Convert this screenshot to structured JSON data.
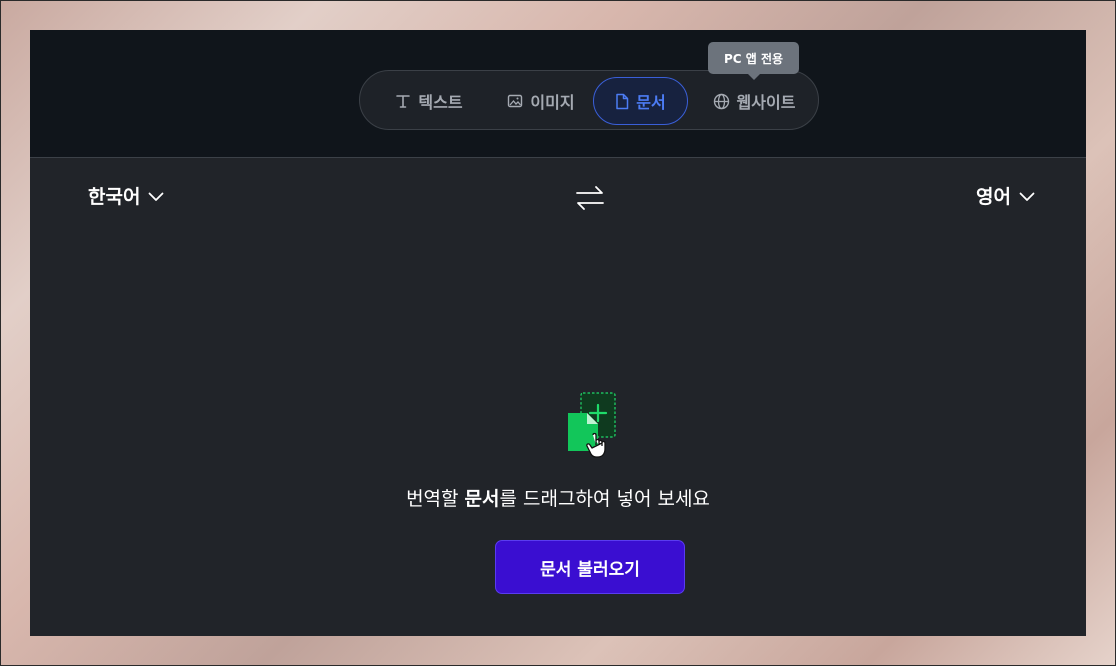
{
  "tabs": [
    {
      "label": "텍스트",
      "icon": "text-t-icon",
      "active": false
    },
    {
      "label": "이미지",
      "icon": "image-icon",
      "active": false
    },
    {
      "label": "문서",
      "icon": "document-icon",
      "active": true
    },
    {
      "label": "웹사이트",
      "icon": "globe-icon",
      "active": false
    }
  ],
  "tooltip": {
    "text": "PC 앱 전용"
  },
  "languages": {
    "source": "한국어",
    "target": "영어"
  },
  "dropzone": {
    "text_before": "번역할 ",
    "text_bold": "문서",
    "text_after": "를 드래그하여 넣어 보세요",
    "icon": "document-drop-icon"
  },
  "load_button": {
    "label": "문서 불러오기"
  },
  "colors": {
    "panel": "#212429",
    "topbar": "#10151b",
    "active_tab": "#4c7cf4",
    "button": "#3a0ed1",
    "doc_green": "#12c65a"
  }
}
